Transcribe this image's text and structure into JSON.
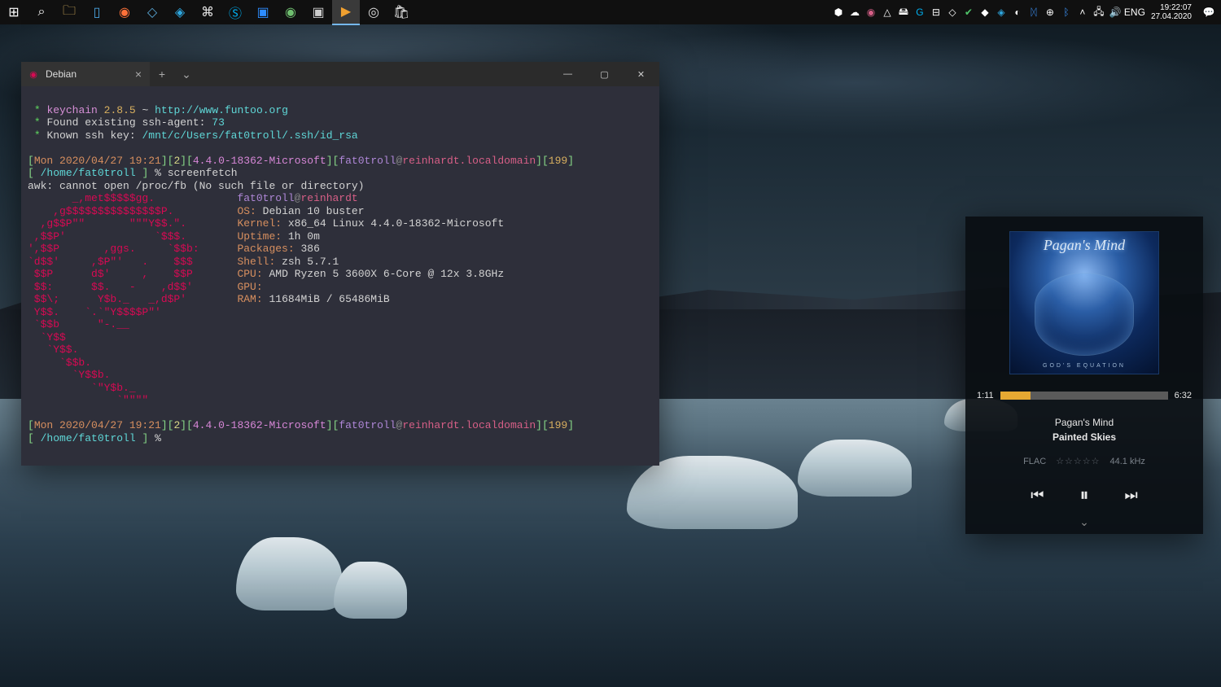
{
  "taskbar": {
    "lang": "ENG",
    "clock_time": "19:22:07",
    "clock_date": "27.04.2020"
  },
  "terminal": {
    "tab_title": "Debian",
    "keychain": {
      "name": "keychain",
      "version": "2.8.5",
      "tilde": "~",
      "url": "http://www.funtoo.org",
      "found": "Found existing ssh-agent:",
      "agent_pid": "73",
      "known": "Known ssh key:",
      "key_path": "/mnt/c/Users/fat0troll/.ssh/id_rsa"
    },
    "prompt1": {
      "date": "Mon 2020/04/27 19:21",
      "seq": "2",
      "kernel": "4.4.0-18362-Microsoft",
      "user": "fat0troll",
      "host": "reinhardt.localdomain",
      "exit": "199",
      "cwd": "/home/fat0troll",
      "cmd": "screenfetch"
    },
    "awk_err": "awk: cannot open /proc/fb (No such file or directory)",
    "fetch": {
      "userhost_u": "fat0troll",
      "userhost_h": "reinhardt",
      "os_l": "OS:",
      "os_v": "Debian 10 buster",
      "kernel_l": "Kernel:",
      "kernel_v": "x86_64 Linux 4.4.0-18362-Microsoft",
      "uptime_l": "Uptime:",
      "uptime_v": "1h 0m",
      "packages_l": "Packages:",
      "packages_v": "386",
      "shell_l": "Shell:",
      "shell_v": "zsh 5.7.1",
      "cpu_l": "CPU:",
      "cpu_v": "AMD Ryzen 5 3600X 6-Core @ 12x 3.8GHz",
      "gpu_l": "GPU:",
      "gpu_v": "",
      "ram_l": "RAM:",
      "ram_v": "11684MiB / 65486MiB"
    },
    "ascii": [
      "       _,met$$$$$gg.          ",
      "    ,g$$$$$$$$$$$$$$$P.       ",
      "  ,g$$P\"\"       \"\"\"Y$$.\".     ",
      " ,$$P'              `$$$.     ",
      "',$$P       ,ggs.     `$$b:   ",
      "`d$$'     ,$P\"'   .    $$$    ",
      " $$P      d$'     ,    $$P    ",
      " $$:      $$.   -    ,d$$'    ",
      " $$\\;      Y$b._   _,d$P'     ",
      " Y$$.    `.`\"Y$$$$P\"'         ",
      " `$$b      \"-.__              ",
      "  `Y$$                        ",
      "   `Y$$.                      ",
      "     `$$b.                    ",
      "       `Y$$b.                 ",
      "          `\"Y$b._             ",
      "              `\"\"\"\"           "
    ],
    "prompt2": {
      "date": "Mon 2020/04/27 19:21",
      "seq": "2",
      "kernel": "4.4.0-18362-Microsoft",
      "user": "fat0troll",
      "host": "reinhardt.localdomain",
      "exit": "199",
      "cwd": "/home/fat0troll"
    }
  },
  "player": {
    "band_art": "Pagan's Mind",
    "album_sub": "GOD'S EQUATION",
    "elapsed": "1:11",
    "total": "6:32",
    "progress_pct": 18,
    "artist": "Pagan's Mind",
    "title": "Painted Skies",
    "format": "FLAC",
    "rate": "44.1 kHz",
    "stars": "☆☆☆☆☆"
  }
}
